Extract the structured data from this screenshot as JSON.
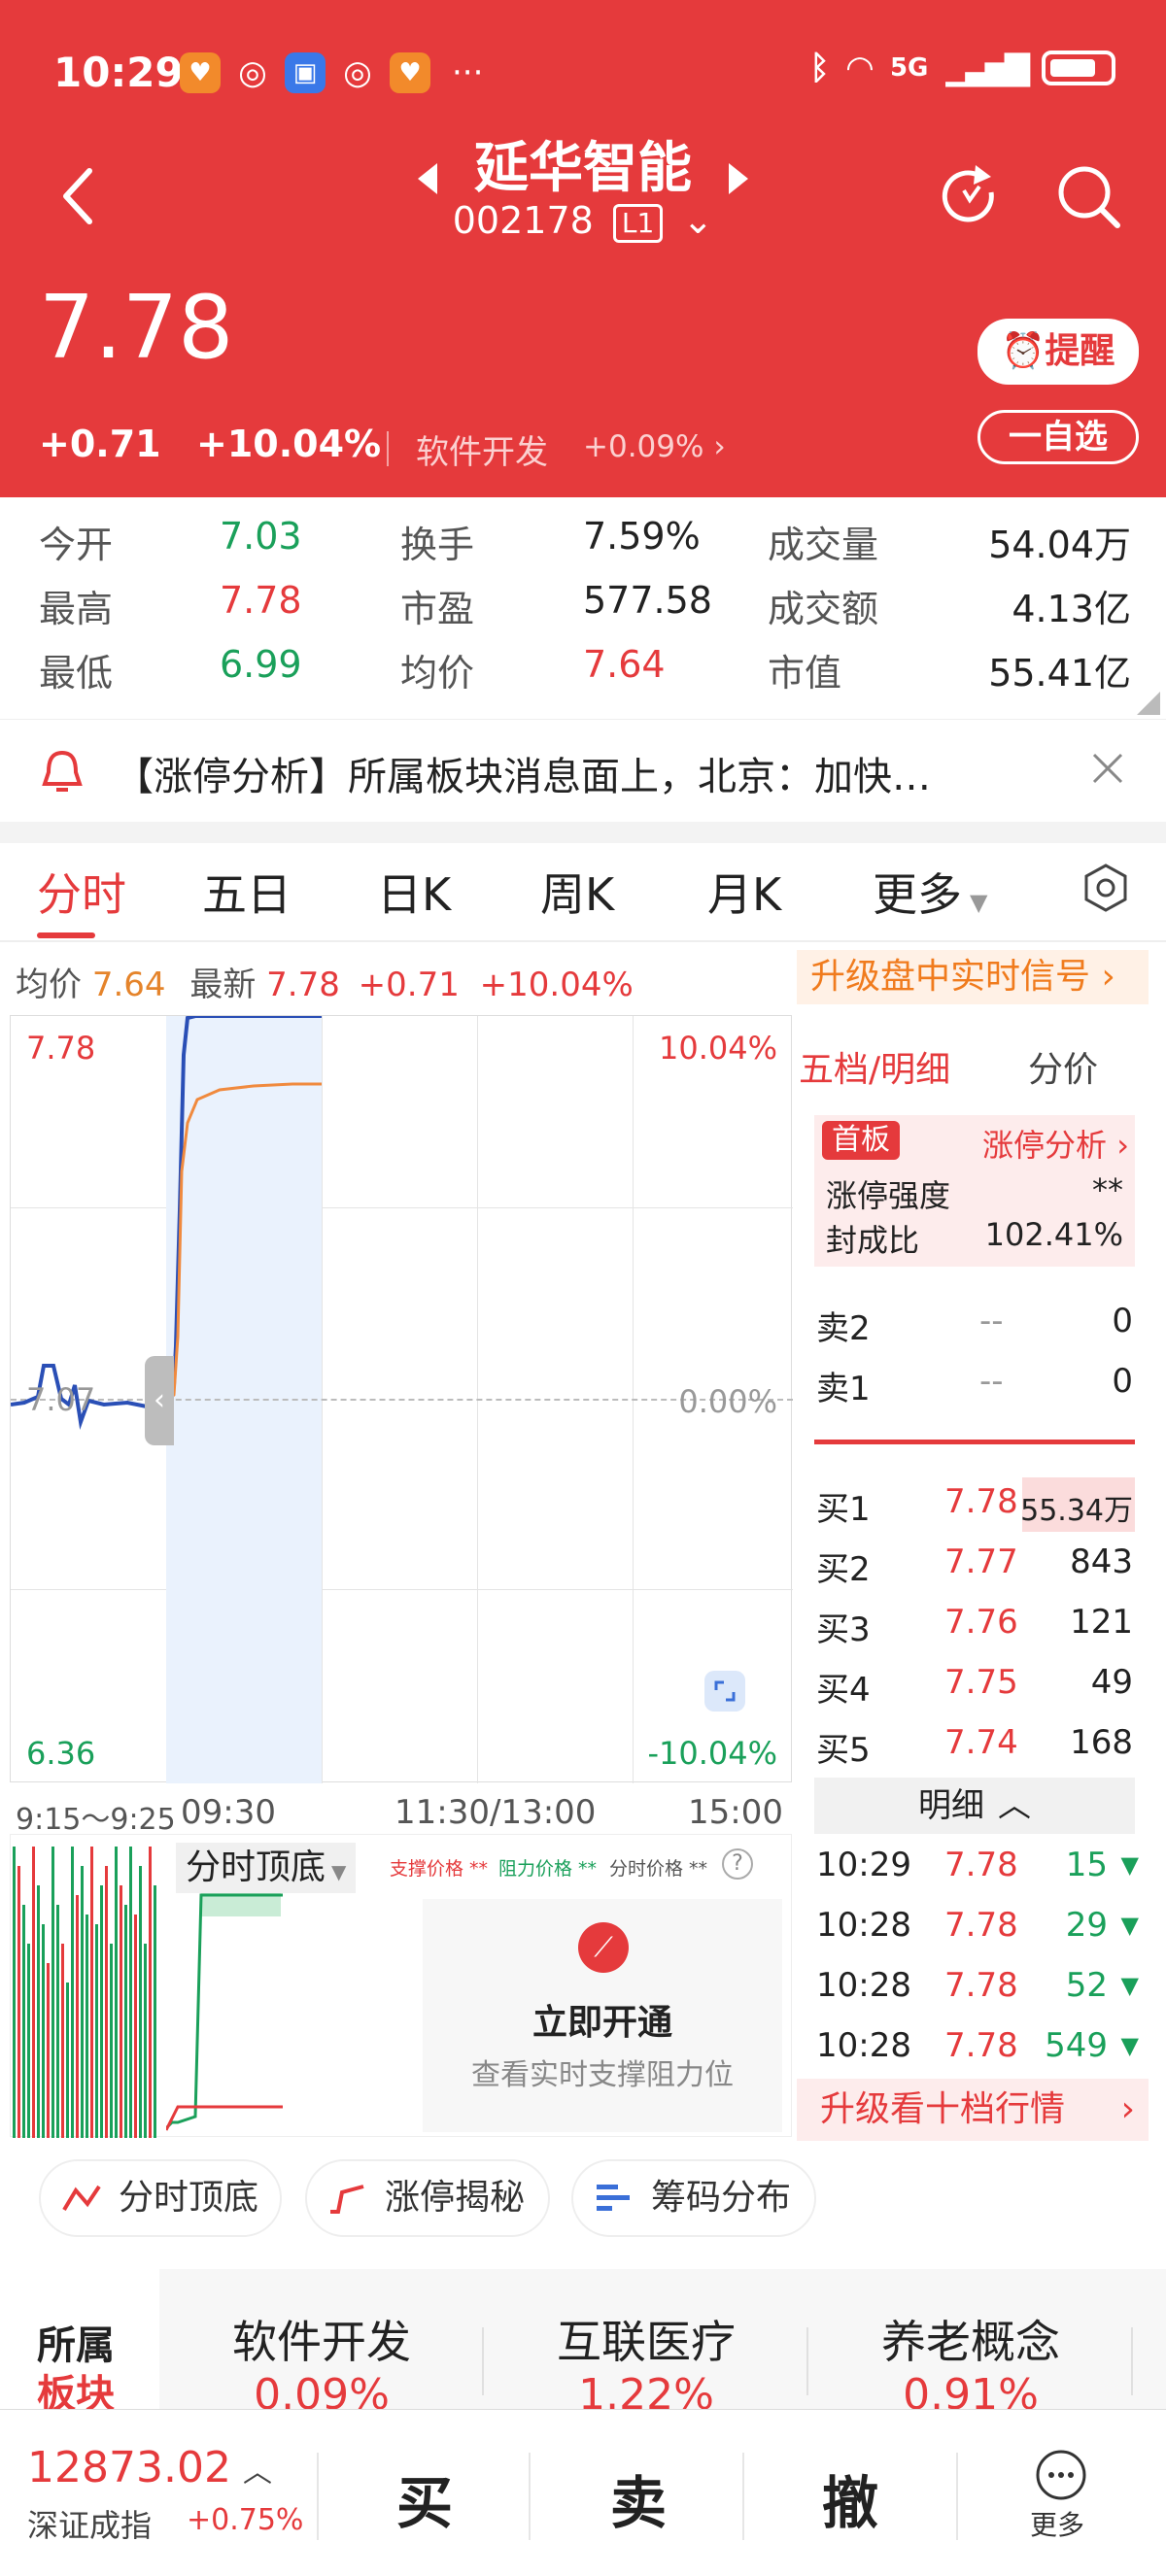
{
  "status_bar": {
    "time": "10:29",
    "network": "5G",
    "more": "···"
  },
  "header": {
    "stock_name": "延华智能",
    "stock_code": "002178",
    "level": "L1",
    "price": "7.78",
    "change": "+0.71",
    "change_pct": "+10.04%",
    "sector": "软件开发",
    "sector_pct": "+0.09%",
    "remind_label": "提醒",
    "watch_label": "一自选"
  },
  "stats": [
    {
      "label": "今开",
      "value": "7.03",
      "color": "#1aa05a"
    },
    {
      "label": "换手",
      "value": "7.59%",
      "color": "#222222"
    },
    {
      "label": "成交量",
      "value": "54.04万",
      "color": "#222222"
    },
    {
      "label": "最高",
      "value": "7.78",
      "color": "#e53a3c"
    },
    {
      "label": "市盈",
      "value": "577.58",
      "color": "#222222"
    },
    {
      "label": "成交额",
      "value": "4.13亿",
      "color": "#222222"
    },
    {
      "label": "最低",
      "value": "6.99",
      "color": "#1aa05a"
    },
    {
      "label": "均价",
      "value": "7.64",
      "color": "#e53a3c"
    },
    {
      "label": "市值",
      "value": "55.41亿",
      "color": "#222222"
    }
  ],
  "news": {
    "text": "【涨停分析】所属板块消息面上，北京：加快…"
  },
  "tabs": [
    "分时",
    "五日",
    "日K",
    "周K",
    "月K",
    "更多"
  ],
  "quote_line": {
    "avg_label": "均价",
    "avg_value": "7.64",
    "latest_label": "最新",
    "latest_value": "7.78",
    "change": "+0.71",
    "change_pct": "+10.04%",
    "upgrade": "升级盘中实时信号"
  },
  "chart": {
    "top_price": "7.78",
    "top_pct": "10.04%",
    "mid_price": "7.07",
    "mid_pct": "0.00%",
    "bottom_price": "6.36",
    "bottom_pct": "-10.04%",
    "time_labels": [
      "9:15～9:25",
      "09:30",
      "11:30/13:00",
      "15:00"
    ]
  },
  "indicator": {
    "title": "分时顶底",
    "legend1": "支撑价格 **",
    "legend2": "阻力价格 **",
    "legend3": "分时价格 **",
    "cta": "立即开通",
    "cta_sub": "查看实时支撑阻力位"
  },
  "order_book": {
    "tab1": "五档/明细",
    "tab2": "分价",
    "badge": "首板",
    "limit_analysis": "涨停分析",
    "strength_label": "涨停强度",
    "strength_value": "**",
    "seal_label": "封成比",
    "seal_value": "102.41%",
    "sells": [
      {
        "label": "卖2",
        "price": "--",
        "vol": "0"
      },
      {
        "label": "卖1",
        "price": "--",
        "vol": "0"
      }
    ],
    "buys": [
      {
        "label": "买1",
        "price": "7.78",
        "vol": "55.34万"
      },
      {
        "label": "买2",
        "price": "7.77",
        "vol": "843"
      },
      {
        "label": "买3",
        "price": "7.76",
        "vol": "121"
      },
      {
        "label": "买4",
        "price": "7.75",
        "vol": "49"
      },
      {
        "label": "买5",
        "price": "7.74",
        "vol": "168"
      }
    ],
    "detail_label": "明细",
    "ticks": [
      {
        "time": "10:29",
        "price": "7.78",
        "vol": "15"
      },
      {
        "time": "10:28",
        "price": "7.78",
        "vol": "29"
      },
      {
        "time": "10:28",
        "price": "7.78",
        "vol": "52"
      },
      {
        "time": "10:28",
        "price": "7.78",
        "vol": "549"
      }
    ],
    "upgrade10": "升级看十档行情"
  },
  "chips": [
    "分时顶底",
    "涨停揭秘",
    "筹码分布"
  ],
  "sector_row": {
    "label1": "所属",
    "label2": "板块",
    "items": [
      {
        "name": "软件开发",
        "pct": "0.09%"
      },
      {
        "name": "互联医疗",
        "pct": "1.22%"
      },
      {
        "name": "养老概念",
        "pct": "0.91%"
      }
    ]
  },
  "bottom": {
    "index_value": "12873.02",
    "index_name": "深证成指",
    "index_pct": "+0.75%",
    "buy": "买",
    "sell": "卖",
    "cancel": "撤",
    "more": "更多"
  }
}
